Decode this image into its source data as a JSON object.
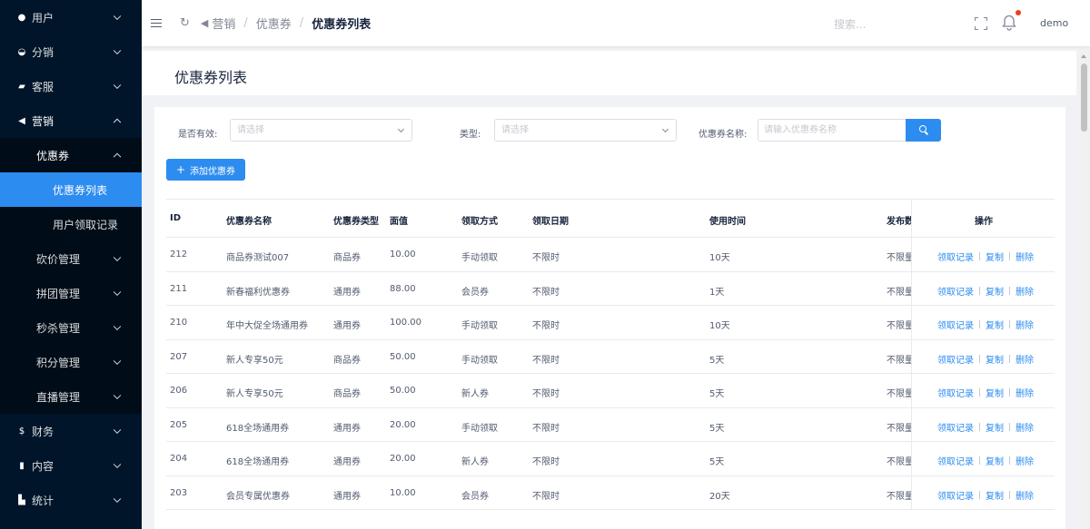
{
  "sidebar": {
    "items": [
      {
        "icon": "👤",
        "icon_name": "user-icon",
        "label": "用户",
        "state": "collapsed"
      },
      {
        "icon": "☯",
        "icon_name": "distribution-icon",
        "label": "分销",
        "state": "collapsed"
      },
      {
        "icon": "▬",
        "icon_name": "chat-icon",
        "label": "客服",
        "state": "collapsed"
      },
      {
        "icon": "➤",
        "icon_name": "send-icon",
        "label": "营销",
        "state": "expanded"
      }
    ],
    "marketing_sub": [
      {
        "label": "优惠券",
        "state": "expanded"
      },
      {
        "label": "砍价管理",
        "state": "collapsed"
      },
      {
        "label": "拼团管理",
        "state": "collapsed"
      },
      {
        "label": "秒杀管理",
        "state": "collapsed"
      },
      {
        "label": "积分管理",
        "state": "collapsed"
      },
      {
        "label": "直播管理",
        "state": "collapsed"
      }
    ],
    "coupon_sub": [
      {
        "label": "优惠券列表",
        "active": true
      },
      {
        "label": "用户领取记录",
        "active": false
      }
    ],
    "bottom_items": [
      {
        "icon": "$",
        "icon_name": "dollar-icon",
        "label": "财务"
      },
      {
        "icon": "▮",
        "icon_name": "book-icon",
        "label": "内容"
      },
      {
        "icon": "▙",
        "icon_name": "bar-chart-icon",
        "label": "统计"
      }
    ]
  },
  "header": {
    "breadcrumb": [
      "营销",
      "优惠券",
      "优惠券列表"
    ],
    "breadcrumb_sep": "/",
    "search_placeholder": "搜索...",
    "user": "demo"
  },
  "page": {
    "title": "优惠券列表"
  },
  "filters": {
    "valid_label": "是否有效:",
    "valid_placeholder": "请选择",
    "type_label": "类型:",
    "type_placeholder": "请选择",
    "name_label": "优惠券名称:",
    "name_placeholder": "请输入优惠券名称"
  },
  "add_button": {
    "plus": "+",
    "label": "添加优惠券"
  },
  "table": {
    "headers": {
      "id": "ID",
      "name": "优惠券名称",
      "type": "优惠券类型",
      "value": "面值",
      "method": "领取方式",
      "date": "领取日期",
      "usage": "使用时间",
      "count": "发布数",
      "ops": "操作"
    },
    "op_labels": {
      "records": "领取记录",
      "copy": "复制",
      "delete": "删除"
    },
    "rows": [
      {
        "id": "212",
        "name": "商品券测试007",
        "type": "商品券",
        "value": "10.00",
        "method": "手动领取",
        "date": "不限时",
        "usage": "10天",
        "count": "不限量"
      },
      {
        "id": "211",
        "name": "新春福利优惠券",
        "type": "通用券",
        "value": "88.00",
        "method": "会员券",
        "date": "不限时",
        "usage": "1天",
        "count": "不限量"
      },
      {
        "id": "210",
        "name": "年中大促全场通用券",
        "type": "通用券",
        "value": "100.00",
        "method": "手动领取",
        "date": "不限时",
        "usage": "10天",
        "count": "不限量"
      },
      {
        "id": "207",
        "name": "新人专享50元",
        "type": "商品券",
        "value": "50.00",
        "method": "手动领取",
        "date": "不限时",
        "usage": "5天",
        "count": "不限量"
      },
      {
        "id": "206",
        "name": "新人专享50元",
        "type": "商品券",
        "value": "50.00",
        "method": "新人券",
        "date": "不限时",
        "usage": "5天",
        "count": "不限量"
      },
      {
        "id": "205",
        "name": "618全场通用券",
        "type": "通用券",
        "value": "20.00",
        "method": "手动领取",
        "date": "不限时",
        "usage": "5天",
        "count": "不限量"
      },
      {
        "id": "204",
        "name": "618全场通用券",
        "type": "通用券",
        "value": "20.00",
        "method": "新人券",
        "date": "不限时",
        "usage": "5天",
        "count": "不限量"
      },
      {
        "id": "203",
        "name": "会员专属优惠券",
        "type": "通用券",
        "value": "10.00",
        "method": "会员券",
        "date": "不限时",
        "usage": "20天",
        "count": "不限量"
      }
    ]
  },
  "colors": {
    "sidebar_bg": "#001529",
    "submenu_bg": "#000c17",
    "accent": "#2d8cf0",
    "badge": "#ed4014"
  }
}
